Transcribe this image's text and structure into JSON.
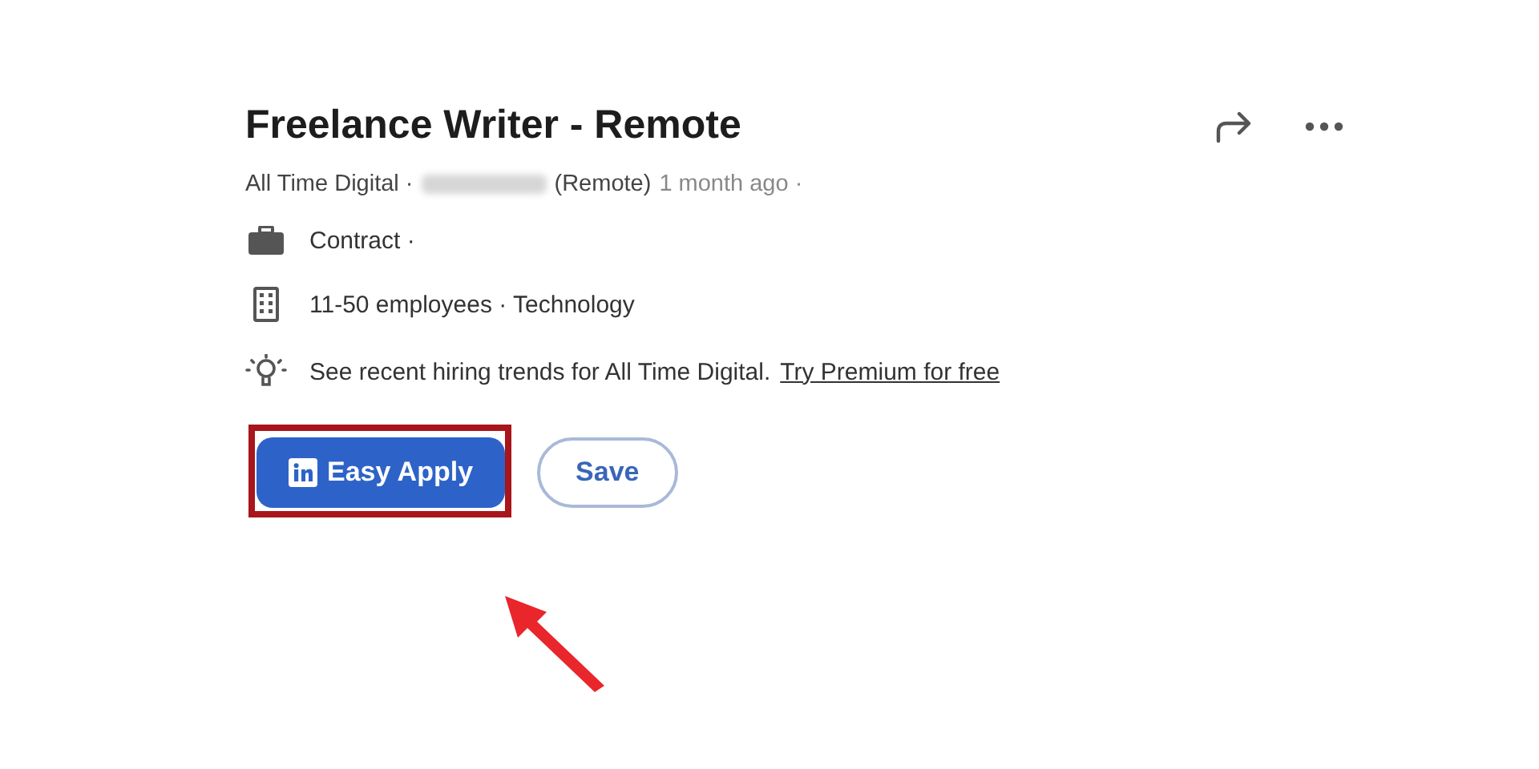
{
  "job": {
    "title": "Freelance Writer - Remote",
    "company": "All Time Digital ·",
    "workplace": "(Remote)",
    "posted": "1 month ago ·"
  },
  "insights": [
    {
      "kind": "briefcase",
      "text": "Contract ·"
    },
    {
      "kind": "building",
      "text": "11-50 employees · Technology"
    },
    {
      "kind": "bulb",
      "text": "See recent hiring trends for All Time Digital.",
      "link": "Try Premium for free"
    }
  ],
  "buttons": [
    {
      "kind": "primary",
      "label": "Easy Apply",
      "highlighted": true
    },
    {
      "kind": "outline",
      "label": "Save",
      "highlighted": false
    }
  ]
}
